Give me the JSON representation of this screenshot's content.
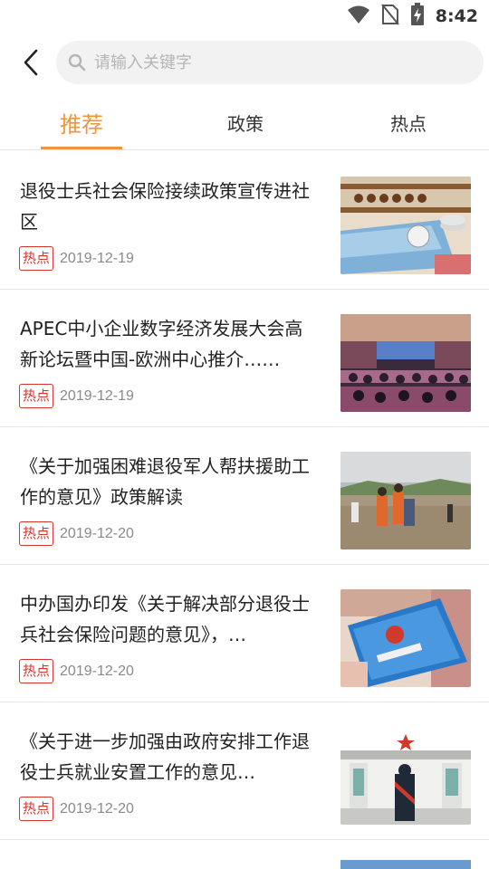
{
  "status_bar": {
    "time": "8:42",
    "icons": [
      "wifi-icon",
      "no-sim-icon",
      "battery-charging-icon"
    ]
  },
  "search": {
    "placeholder": "请输入关键字",
    "value": ""
  },
  "tabs": [
    {
      "label": "推荐",
      "active": true
    },
    {
      "label": "政策",
      "active": false
    },
    {
      "label": "热点",
      "active": false
    }
  ],
  "colors": {
    "accent": "#f0953a",
    "hot": "#d9342b"
  },
  "news": [
    {
      "title": "退役士兵社会保险接续政策宣传进社区",
      "badge": "热点",
      "date": "2019-12-19",
      "thumb": "abacus-card-photo"
    },
    {
      "title": "APEC中小企业数字经济发展大会高新论坛暨中国-欧洲中心推介……",
      "badge": "热点",
      "date": "2019-12-19",
      "thumb": "conference-hall-photo"
    },
    {
      "title": "《关于加强困难退役军人帮扶援助工作的意见》政策解读",
      "badge": "热点",
      "date": "2019-12-20",
      "thumb": "flood-rescue-photo"
    },
    {
      "title": "中办国办印发《关于解决部分退役士兵社会保险问题的意见》，…",
      "badge": "热点",
      "date": "2019-12-20",
      "thumb": "social-security-card-photo"
    },
    {
      "title": "《关于进一步加强由政府安排工作退役士兵就业安置工作的意见…",
      "badge": "热点",
      "date": "2019-12-20",
      "thumb": "soldier-salute-gate-photo"
    }
  ]
}
